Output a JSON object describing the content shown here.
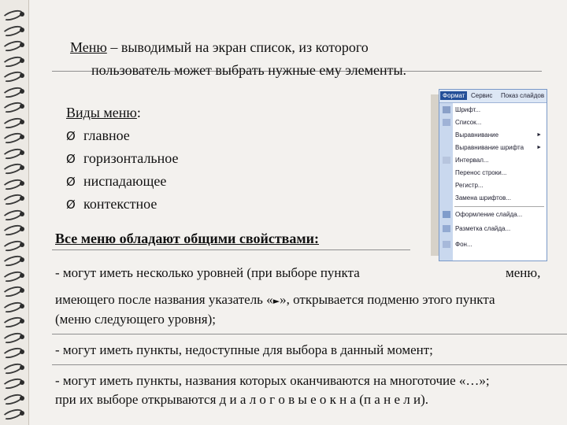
{
  "definition": {
    "term": "Меню",
    "line1": " – выводимый на экран список, из которого",
    "line2": "пользователь может выбрать нужные ему элементы."
  },
  "types": {
    "heading": "Виды меню",
    "colon": ":",
    "bullet": "Ø",
    "items": [
      "главное",
      "горизонтальное",
      "ниспадающее",
      "контекстное"
    ]
  },
  "properties": {
    "heading": "Все меню обладают общими свойствами:",
    "p1_line1a": "- могут иметь несколько уровней (при выборе пункта",
    "p1_line1b": "меню,",
    "p1_line2": "имеющего после названия указатель «",
    "p1_line2_marker": "►",
    "p1_line2_end": "», открывается подменю этого пункта",
    "p1_line3": "(меню следующего уровня);",
    "p2": "- могут иметь пункты, недоступные для выбора в данный момент;",
    "p3_line1": "- могут иметь пункты, названия которых оканчиваются на многоточие «…»;",
    "p3_line2a": "при их выборе  открываются ",
    "p3_line2b": "д и а л о г о в ы е   о к н а  (п а н е л и)."
  },
  "menu": {
    "bar": [
      "Формат",
      "Сервис",
      "Показ слайдов"
    ],
    "items": [
      {
        "label": "Шрифт...",
        "arrow": false
      },
      {
        "label": "Список...",
        "arrow": false
      },
      {
        "label": "Выравнивание",
        "arrow": true
      },
      {
        "label": "Выравнивание шрифта",
        "arrow": true
      },
      {
        "label": "Интервал...",
        "arrow": false
      },
      {
        "label": "Перенос строки...",
        "arrow": false
      },
      {
        "label": "Регистр...",
        "arrow": false
      },
      {
        "label": "Замена шрифтов...",
        "arrow": false
      },
      {
        "label": "Оформление слайда...",
        "arrow": false
      },
      {
        "label": "Разметка слайда...",
        "arrow": false
      },
      {
        "label": "Фон...",
        "arrow": false
      }
    ],
    "arrow_glyph": "►"
  }
}
